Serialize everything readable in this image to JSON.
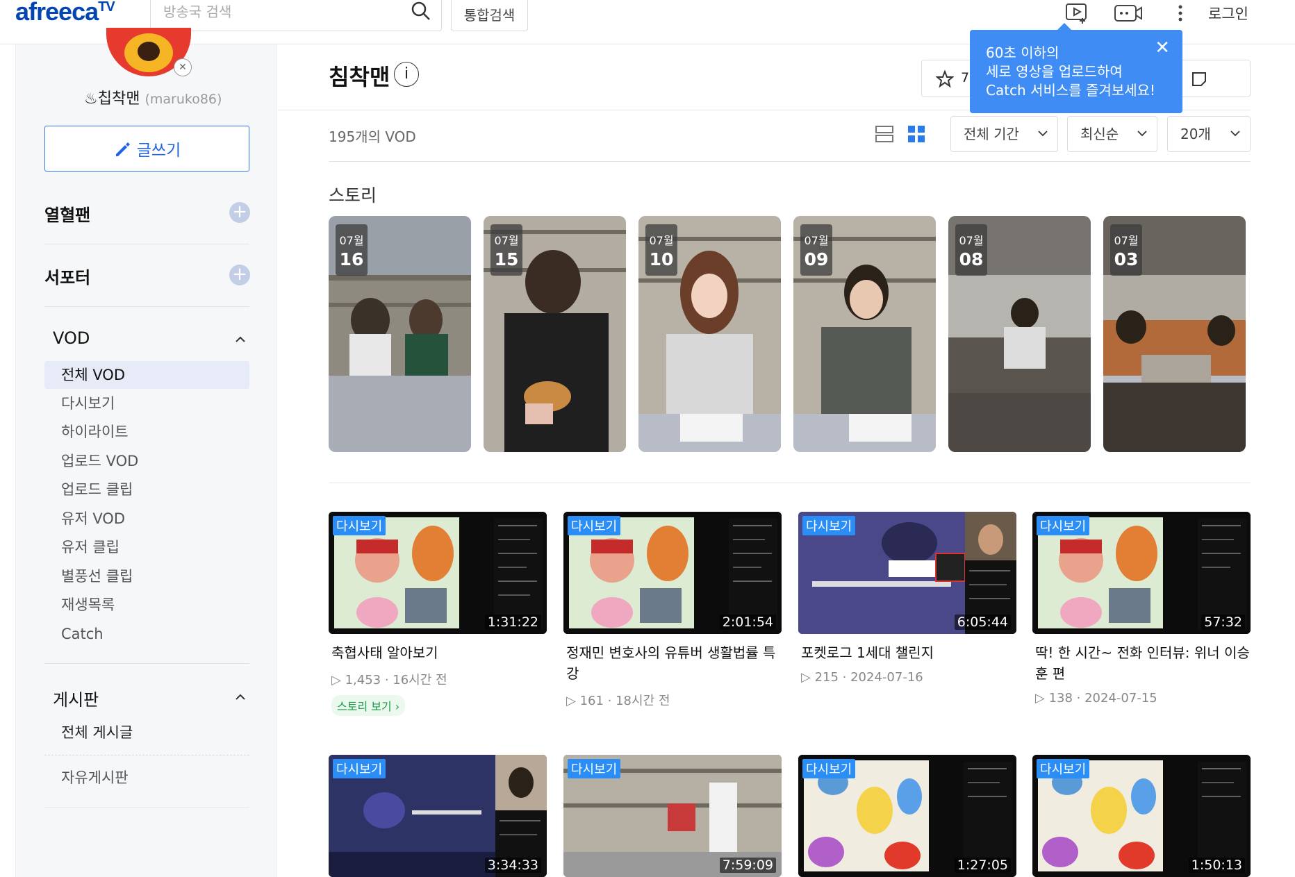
{
  "header": {
    "logo_text": "afreeca",
    "logo_tv": "TV",
    "search_placeholder": "방송국 검색",
    "total_search": "통합검색",
    "login": "로그인"
  },
  "sidebar": {
    "nickname": "♨칩착맨",
    "user_id": "(maruko86)",
    "write_button": "글쓰기",
    "fan_label": "열혈팬",
    "supporter_label": "서포터",
    "vod_label": "VOD",
    "vod_items": [
      "전체 VOD",
      "다시보기",
      "하이라이트",
      "업로드 VOD",
      "업로드 클립",
      "유저 VOD",
      "유저 클립",
      "별풍선 클립",
      "재생목록",
      "Catch"
    ],
    "board_label": "게시판",
    "board_items": [
      "전체 게시글",
      "자유게시판"
    ]
  },
  "channel": {
    "title": "침착맨",
    "info_icon": "i",
    "fav_count_partial": "7"
  },
  "tooltip": {
    "line1": "60초 이하의",
    "line2": "세로 영상을 업로드하여",
    "line3": "Catch 서비스를 즐겨보세요!",
    "close": "✕"
  },
  "toolbar": {
    "vod_count": "195개의 VOD",
    "period": "전체 기간",
    "sort": "최신순",
    "per_page": "20개"
  },
  "stories": {
    "title": "스토리",
    "items": [
      {
        "month": "07월",
        "day": "16"
      },
      {
        "month": "07월",
        "day": "15"
      },
      {
        "month": "07월",
        "day": "10"
      },
      {
        "month": "07월",
        "day": "09"
      },
      {
        "month": "07월",
        "day": "08"
      },
      {
        "month": "07월",
        "day": "03"
      }
    ]
  },
  "videos": [
    {
      "tag": "다시보기",
      "duration": "1:31:22",
      "title": "축협사태 알아보기",
      "views": "1,453",
      "time": "16시간 전",
      "story_link": "스토리 보기"
    },
    {
      "tag": "다시보기",
      "duration": "2:01:54",
      "title": "정재민 변호사의 유튜버 생활법률 특강",
      "views": "161",
      "time": "18시간 전"
    },
    {
      "tag": "다시보기",
      "duration": "6:05:44",
      "title": "포켓로그 1세대 챌린지",
      "views": "215",
      "time": "2024-07-16"
    },
    {
      "tag": "다시보기",
      "duration": "57:32",
      "title": "딱! 한 시간~ 전화 인터뷰: 위너 이승훈 편",
      "views": "138",
      "time": "2024-07-15"
    },
    {
      "tag": "다시보기",
      "duration": "3:34:33"
    },
    {
      "tag": "다시보기",
      "duration": "7:59:09"
    },
    {
      "tag": "다시보기",
      "duration": "1:27:05"
    },
    {
      "tag": "다시보기",
      "duration": "1:50:13"
    }
  ],
  "colors": {
    "brand": "#0545b1",
    "accent": "#2a8ef6",
    "tooltip": "#3f8cf5",
    "story_link": "#1a9c48"
  }
}
